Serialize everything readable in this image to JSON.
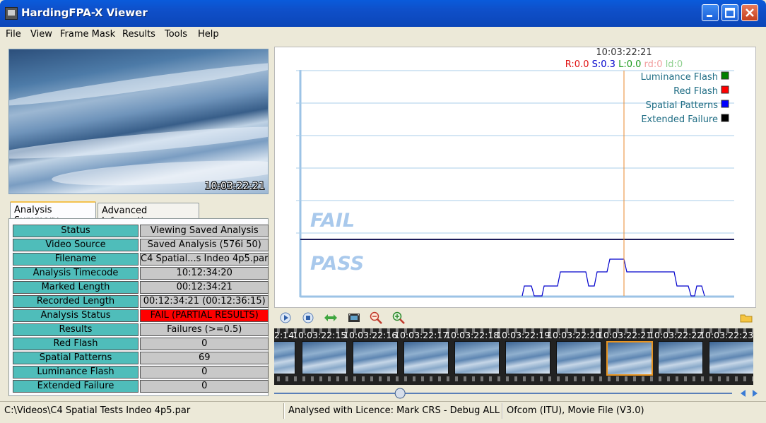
{
  "window": {
    "title": "HardingFPA-X Viewer"
  },
  "menu": {
    "items": [
      "File",
      "View",
      "Frame Mask",
      "Results",
      "Tools",
      "Help"
    ]
  },
  "video": {
    "timecode": "10:03:22:21"
  },
  "tabs": {
    "summary": "Analysis Summary",
    "advanced": "Advanced Information"
  },
  "summary": {
    "rows": [
      {
        "key": "Status",
        "value": "Viewing Saved Analysis"
      },
      {
        "key": "Video Source",
        "value": "Saved Analysis (576i 50)"
      },
      {
        "key": "Filename",
        "value": "C4 Spatial...s Indeo 4p5.par"
      },
      {
        "key": "Analysis Timecode",
        "value": "10:12:34:20"
      },
      {
        "key": "Marked Length",
        "value": "00:12:34:21"
      },
      {
        "key": "Recorded Length",
        "value": "00:12:34:21 (00:12:36:15)"
      },
      {
        "key": "Analysis Status",
        "value": "FAIL (PARTIAL RESULTS)"
      },
      {
        "key": "Results",
        "value": "Failures (>=0.5)"
      },
      {
        "key": "Red Flash",
        "value": "0"
      },
      {
        "key": "Spatial Patterns",
        "value": "69"
      },
      {
        "key": "Luminance Flash",
        "value": "0"
      },
      {
        "key": "Extended Failure",
        "value": "0"
      }
    ],
    "fail_color": "#FF0000",
    "key_color": "#4FBDBA"
  },
  "graph": {
    "cursor_timecode": "10:03:22:21",
    "readout": {
      "r": "R:0.0",
      "s": "S:0.3",
      "l": "L:0.0",
      "rd": "rd:0",
      "ld": "ld:0"
    },
    "fail_label": "FAIL",
    "pass_label": "PASS",
    "legend": [
      {
        "label": "Luminance Flash",
        "color": "#008000"
      },
      {
        "label": "Red Flash",
        "color": "#FF0000"
      },
      {
        "label": "Spatial Patterns",
        "color": "#0000FF"
      },
      {
        "label": "Extended Failure",
        "color": "#000000"
      }
    ]
  },
  "toolbar": {
    "icons": [
      "play-icon",
      "stop-icon",
      "fit-width-icon",
      "film-icon",
      "zoom-out-icon",
      "zoom-in-icon",
      "folder-icon"
    ]
  },
  "filmstrip": {
    "timecodes": [
      "10:03:22:14",
      "10:03:22:15",
      "10:03:22:16",
      "10:03:22:17",
      "10:03:22:18",
      "10:03:22:19",
      "10:03:22:20",
      "10:03:22:21",
      "10:03:22:22",
      "10:03:22:23"
    ],
    "first_visible": "2:14",
    "selected_index": 7
  },
  "slider": {
    "position": 0.27
  },
  "statusbar": {
    "path": "C:\\Videos\\C4 Spatial Tests Indeo 4p5.par",
    "licence": "Analysed with Licence: Mark CRS - Debug ALL",
    "standard": "Ofcom (ITU), Movie File (V3.0)"
  }
}
